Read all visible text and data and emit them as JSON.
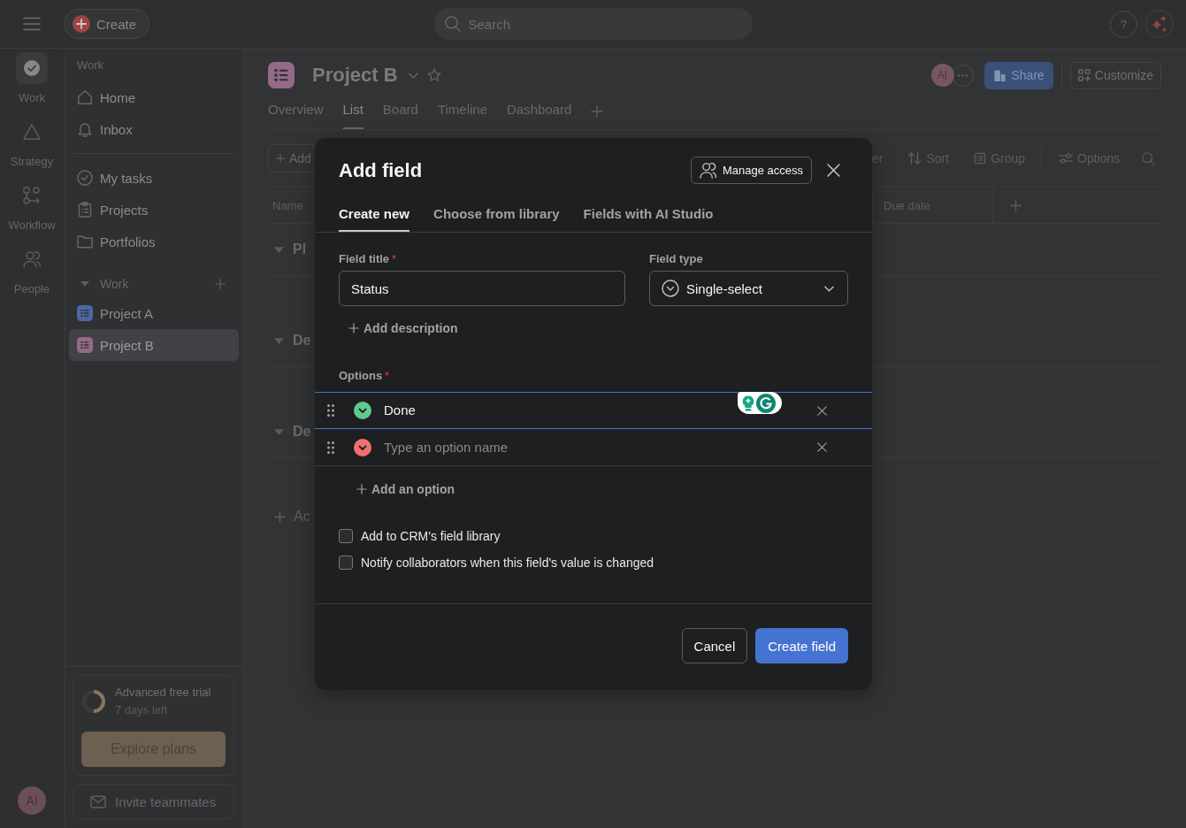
{
  "top_bar": {
    "create": "Create",
    "search": {
      "placeholder": "Search"
    },
    "help": "?"
  },
  "rail": {
    "items": [
      {
        "label": "Work",
        "selected": true
      },
      {
        "label": "Strategy",
        "selected": false
      },
      {
        "label": "Workflow",
        "selected": false
      },
      {
        "label": "People",
        "selected": false
      }
    ],
    "avatar": "AI"
  },
  "sidebar": {
    "heading": "Work",
    "items": [
      {
        "label": "Home"
      },
      {
        "label": "Inbox"
      }
    ],
    "my_items": [
      {
        "label": "My tasks"
      },
      {
        "label": "Projects"
      },
      {
        "label": "Portfolios"
      }
    ],
    "section": {
      "title": "Work",
      "expanded": true,
      "projects": [
        {
          "label": "Project A",
          "color": "#4d68a0",
          "selected": false
        },
        {
          "label": "Project B",
          "color": "#946a89",
          "selected": true
        }
      ]
    },
    "trial": {
      "title": "Advanced free trial",
      "subtitle": "7 days left",
      "level": 0.5,
      "button": "Explore plans"
    },
    "invite": "Invite teammates"
  },
  "project": {
    "title": "Project B",
    "color": "#946a89",
    "avatar": "AI",
    "share": "Share",
    "customize": "Customize",
    "tabs": [
      {
        "label": "Overview",
        "selected": false
      },
      {
        "label": "List",
        "selected": true
      },
      {
        "label": "Board",
        "selected": false
      },
      {
        "label": "Timeline",
        "selected": false
      },
      {
        "label": "Dashboard",
        "selected": false
      }
    ]
  },
  "toolbar": {
    "add": "Add",
    "items": [
      {
        "label": "er"
      },
      {
        "label": "Sort"
      },
      {
        "label": "Group"
      },
      {
        "label": "Options"
      }
    ]
  },
  "table": {
    "columns": [
      "Name",
      "Due date"
    ],
    "sections": [
      {
        "title": "Pl",
        "expanded": true
      },
      {
        "title": "De",
        "expanded": true
      },
      {
        "title": "De",
        "expanded": true
      }
    ],
    "add_section": "Ac"
  },
  "modal": {
    "title": "Add field",
    "manage_access": "Manage access",
    "tabs": [
      {
        "label": "Create new",
        "selected": true
      },
      {
        "label": "Choose from library",
        "selected": false
      },
      {
        "label": "Fields with AI Studio",
        "selected": false
      }
    ],
    "field_title": {
      "label": "Field title",
      "required_mark": "*",
      "value": "Status"
    },
    "field_type": {
      "label": "Field type",
      "value": "Single-select"
    },
    "add_description": "Add description",
    "options": {
      "label": "Options",
      "required_mark": "*",
      "items": [
        {
          "value": "Done",
          "color": "#62c98e",
          "focused": true
        },
        {
          "placeholder": "Type an option name",
          "color": "#f26f6f",
          "focused": false
        }
      ]
    },
    "add_option": "Add an option",
    "checkboxes": [
      {
        "label": "Add to CRM's field library",
        "checked": false
      },
      {
        "label": "Notify collaborators when this field's value is changed",
        "checked": false
      }
    ],
    "cancel": "Cancel",
    "submit": "Create field"
  }
}
